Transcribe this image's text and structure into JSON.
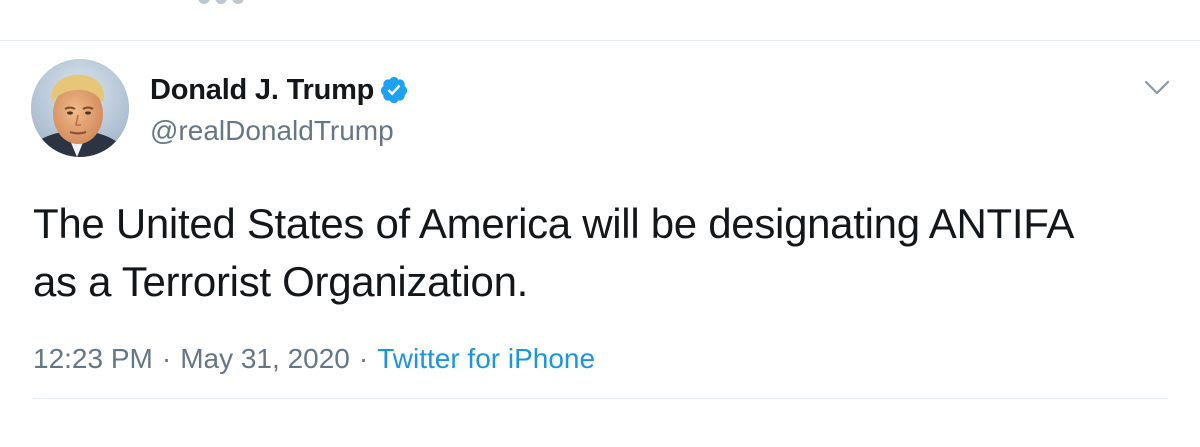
{
  "tweet": {
    "author": {
      "display_name": "Donald J. Trump",
      "handle": "@realDonaldTrump",
      "verified": true
    },
    "text_lines": [
      "The United States of America will be designating ANTIFA",
      "as a Terrorist Organization."
    ],
    "meta": {
      "time": "12:23 PM",
      "date": "May 31, 2020",
      "separator": "·",
      "source": "Twitter for iPhone"
    },
    "icons": {
      "verified": "verified-badge-icon",
      "menu": "chevron-down-icon"
    }
  },
  "colors": {
    "text": "#14171a",
    "secondary_text": "#657786",
    "link": "#1b95e0",
    "verified": "#1da1f2",
    "divider": "#e6ecf0"
  }
}
